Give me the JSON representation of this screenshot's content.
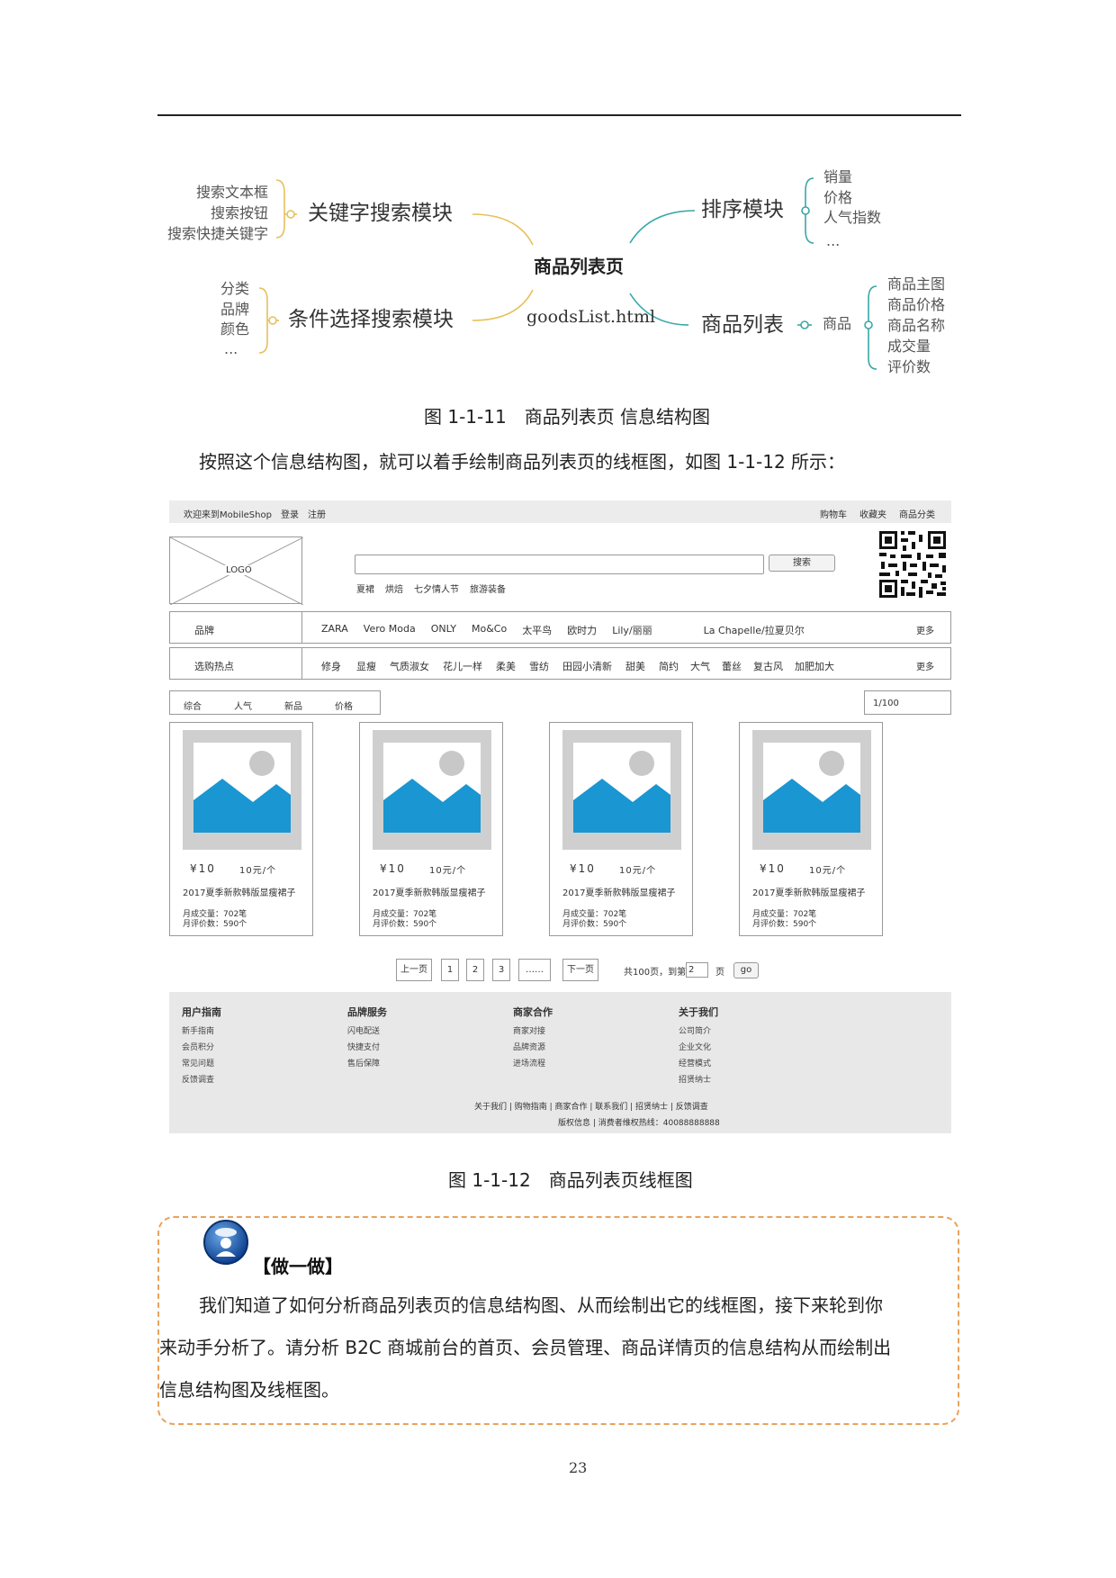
{
  "mindmap": {
    "center_title": "商品列表页",
    "center_file": "goodsList.html",
    "keyword_module": {
      "label": "关键字搜索模块",
      "items": [
        "搜索文本框",
        "搜索按钮",
        "搜索快捷关键字"
      ]
    },
    "condition_module": {
      "label": "条件选择搜索模块",
      "items": [
        "分类",
        "品牌",
        "颜色",
        "..."
      ]
    },
    "sort_module": {
      "label": "排序模块",
      "items": [
        "销量",
        "价格",
        "人气指数",
        "..."
      ]
    },
    "list_module": {
      "label": "商品列表",
      "mid": "商品",
      "items": [
        "商品主图",
        "商品价格",
        "商品名称",
        "成交量",
        "评价数"
      ]
    }
  },
  "figure1_caption": "图 1-1-11　商品列表页 信息结构图",
  "intro_paragraph": "按照这个信息结构图，就可以着手绘制商品列表页的线框图，如图 1-1-12 所示：",
  "wireframe": {
    "topbar_left": [
      "欢迎来到MobileShop",
      "登录",
      "注册"
    ],
    "topbar_right": [
      "购物车",
      "收藏夹",
      "商品分类"
    ],
    "logo": "LOGO",
    "search_button": "搜索",
    "hot_keywords": [
      "夏裙",
      "烘焙",
      "七夕情人节",
      "旅游装备"
    ],
    "brand_label": "品牌",
    "brands": [
      "ZARA",
      "Vero Moda",
      "ONLY",
      "Mo&Co",
      "太平鸟",
      "欧时力",
      "Lily/丽丽",
      "La Chapelle/拉夏贝尔"
    ],
    "hot_label": "选购热点",
    "hot_points": [
      "修身",
      "显瘦",
      "气质淑女",
      "花儿一样",
      "柔美",
      "雪纺",
      "田园小清新",
      "甜美",
      "简约",
      "大气",
      "蕾丝",
      "复古风",
      "加肥加大"
    ],
    "more": "更多",
    "sort_options": [
      "综合",
      "人气",
      "新品",
      "价格"
    ],
    "page_count": "1/100",
    "product": {
      "price": "¥10",
      "unit_price": "10元/个",
      "name": "2017夏季新款韩版显瘦裙子",
      "monthly_sales": "月成交量：702笔",
      "monthly_reviews": "月评价数：590个"
    },
    "pagination": {
      "prev": "上一页",
      "pages": [
        "1",
        "2",
        "3"
      ],
      "ellipsis": "……",
      "next": "下一页",
      "total_text": "共100页，到第",
      "input_value": "2",
      "page_suffix": "页",
      "go": "go"
    },
    "footer_columns": [
      {
        "title": "用户指南",
        "items": [
          "新手指南",
          "会员积分",
          "常见问题",
          "反馈调查"
        ]
      },
      {
        "title": "品牌服务",
        "items": [
          "闪电配送",
          "快捷支付",
          "售后保障"
        ]
      },
      {
        "title": "商家合作",
        "items": [
          "商家对接",
          "品牌资源",
          "进场流程"
        ]
      },
      {
        "title": "关于我们",
        "items": [
          "公司简介",
          "企业文化",
          "经营模式",
          "招贤纳士"
        ]
      }
    ],
    "footer_links": "关于我们 | 购物指南 | 商家合作 | 联系我们 | 招贤纳士 | 反馈调查",
    "footer_copyright": "版权信息 | 消费者维权热线：40088888888"
  },
  "figure2_caption": "图 1-1-12　商品列表页线框图",
  "practice": {
    "title": "【做一做】",
    "lines": [
      "我们知道了如何分析商品列表页的信息结构图、从而绘制出它的线框图，接下来轮到你",
      "来动手分析了。请分析 B2C 商城前台的首页、会员管理、商品详情页的信息结构从而绘制出",
      "信息结构图及线框图。"
    ]
  },
  "page_number": "23",
  "colors": {
    "accent_orange": "#e8a25c",
    "map_yellow": "#e6c05a",
    "map_teal": "#3aa6a6",
    "image_blue": "#1a96d2"
  }
}
